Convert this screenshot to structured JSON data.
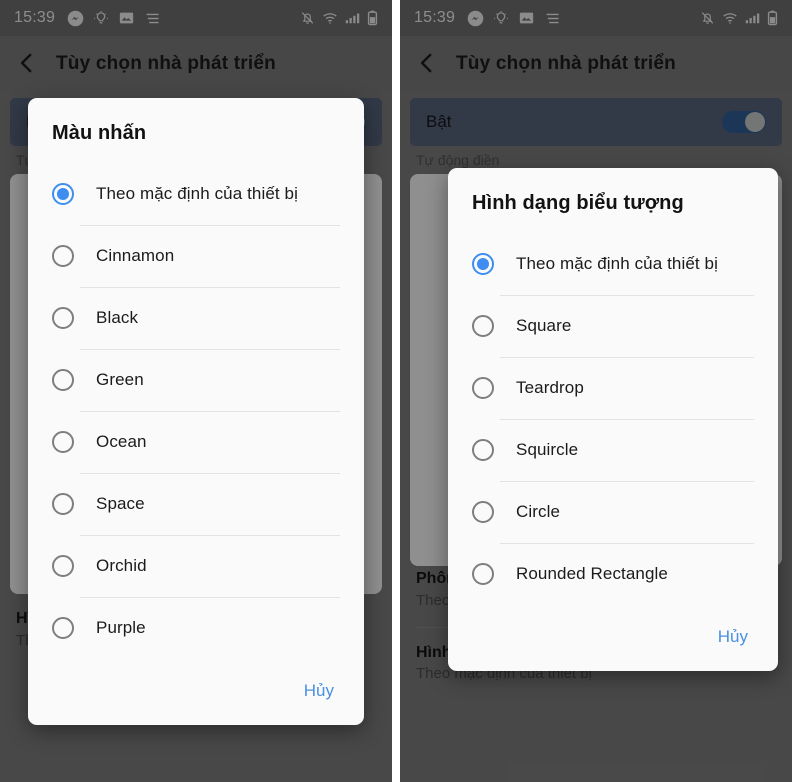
{
  "status_bar": {
    "time": "15:39",
    "left_icons": [
      "messenger-icon",
      "lightbulb-icon",
      "image-icon",
      "menu-lines-icon"
    ],
    "right_icons": [
      "bell-muted-icon",
      "wifi-icon",
      "signal-bars-icon",
      "battery-icon"
    ]
  },
  "app_bar": {
    "back_icon": "back-chevron-icon",
    "title": "Tùy chọn nhà phát triển"
  },
  "colors": {
    "accent": "#3d8ef0",
    "link": "#4a90e2",
    "toggle_track": "#2f5d94",
    "toggle_card": "#56637a",
    "scrim": "rgba(0,0,0,0.42)"
  },
  "left_screen": {
    "background": {
      "rows": [
        {
          "title": "Hình dạng biểu tượng",
          "sub": "Theo mặc định của thiết bị"
        }
      ]
    },
    "dialog": {
      "title": "Màu nhấn",
      "options": [
        {
          "label": "Theo mặc định của thiết bị",
          "selected": true
        },
        {
          "label": "Cinnamon",
          "selected": false
        },
        {
          "label": "Black",
          "selected": false
        },
        {
          "label": "Green",
          "selected": false
        },
        {
          "label": "Ocean",
          "selected": false
        },
        {
          "label": "Space",
          "selected": false
        },
        {
          "label": "Orchid",
          "selected": false
        },
        {
          "label": "Purple",
          "selected": false
        }
      ],
      "cancel_label": "Hủy"
    }
  },
  "right_screen": {
    "background": {
      "toggle": {
        "label": "Bật",
        "on": true
      },
      "section_label": "Tự động điền",
      "rows": [
        {
          "title": "Phông chữ tiêu đề / nội dung",
          "sub": "Theo mặc định của thiết bị"
        },
        {
          "title": "Hình dạng biểu tượng",
          "sub": "Theo mặc định của thiết bị"
        }
      ]
    },
    "dialog": {
      "title": "Hình dạng biểu tượng",
      "options": [
        {
          "label": "Theo mặc định của thiết bị",
          "selected": true
        },
        {
          "label": "Square",
          "selected": false
        },
        {
          "label": "Teardrop",
          "selected": false
        },
        {
          "label": "Squircle",
          "selected": false
        },
        {
          "label": "Circle",
          "selected": false
        },
        {
          "label": "Rounded Rectangle",
          "selected": false
        }
      ],
      "cancel_label": "Hủy"
    }
  }
}
